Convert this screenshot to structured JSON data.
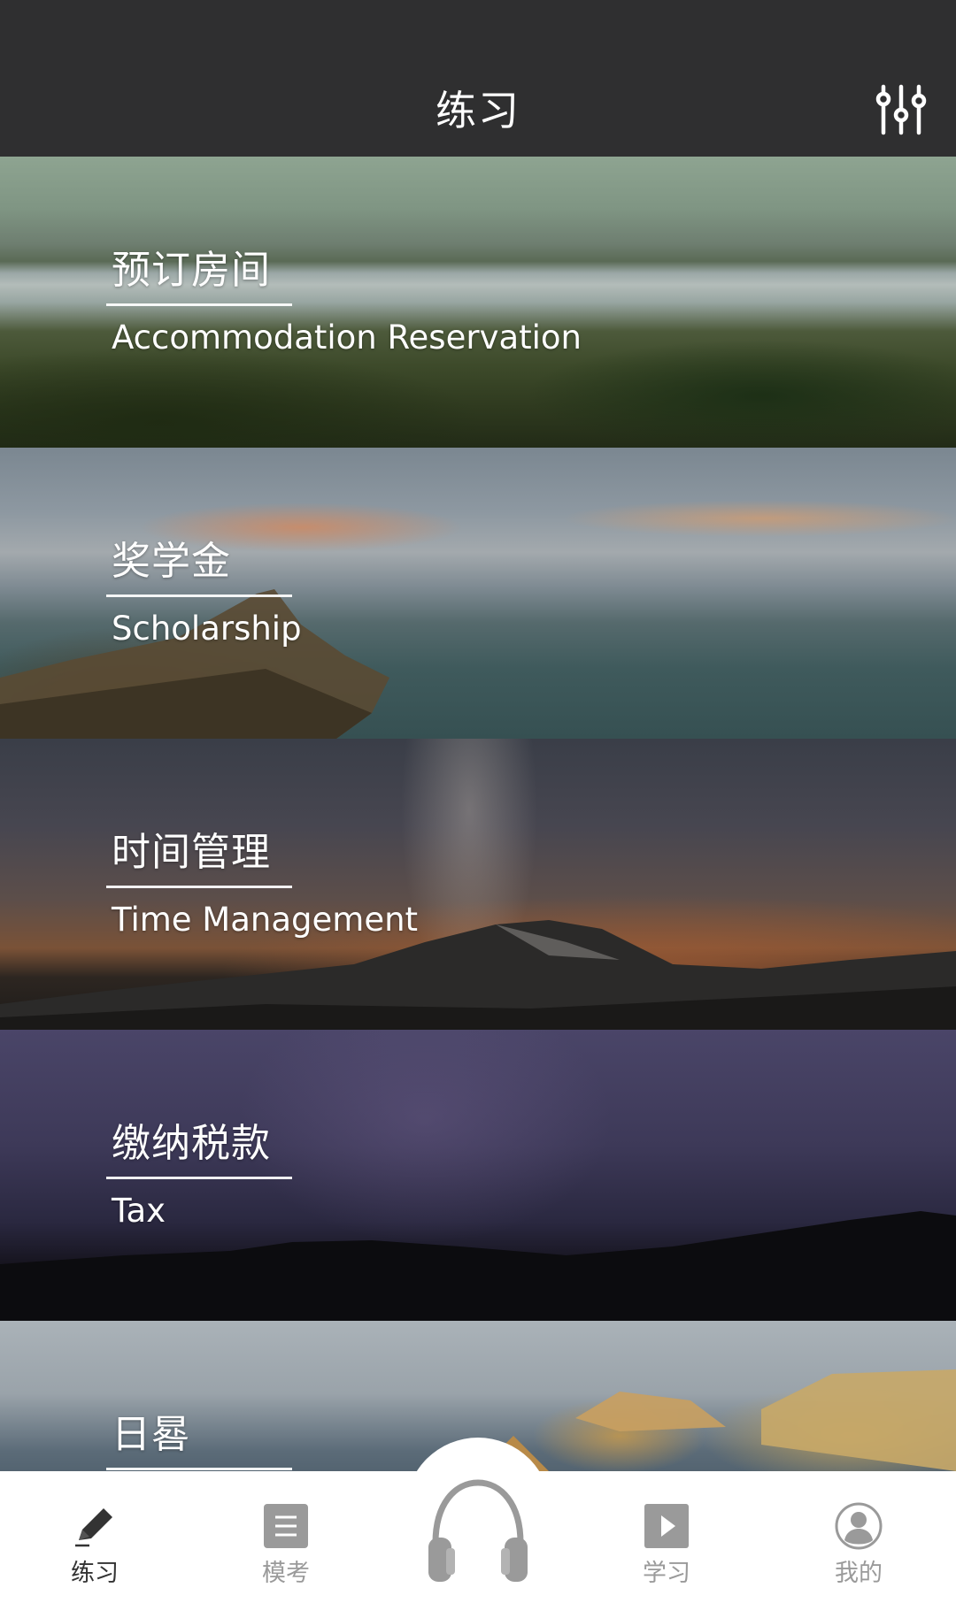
{
  "header": {
    "title": "练习",
    "filter_icon": "sliders-icon"
  },
  "topics": [
    {
      "title_cn": "预订房间",
      "title_en": "Accommodation Reservation"
    },
    {
      "title_cn": "奖学金",
      "title_en": "Scholarship"
    },
    {
      "title_cn": "时间管理",
      "title_en": "Time Management"
    },
    {
      "title_cn": "缴纳税款",
      "title_en": "Tax"
    },
    {
      "title_cn": "日晷",
      "title_en": ""
    }
  ],
  "bottom_nav": {
    "items": [
      {
        "label": "练习",
        "icon": "pencil-icon",
        "active": true
      },
      {
        "label": "模考",
        "icon": "document-icon",
        "active": false
      },
      {
        "label": "",
        "icon": "headphones-icon",
        "active": false
      },
      {
        "label": "学习",
        "icon": "play-icon",
        "active": false
      },
      {
        "label": "我的",
        "icon": "user-icon",
        "active": false
      }
    ]
  },
  "colors": {
    "header_bg": "#2f2f30",
    "nav_bg": "#ffffff",
    "nav_active": "#333333",
    "nav_inactive": "#9a9a9a"
  }
}
